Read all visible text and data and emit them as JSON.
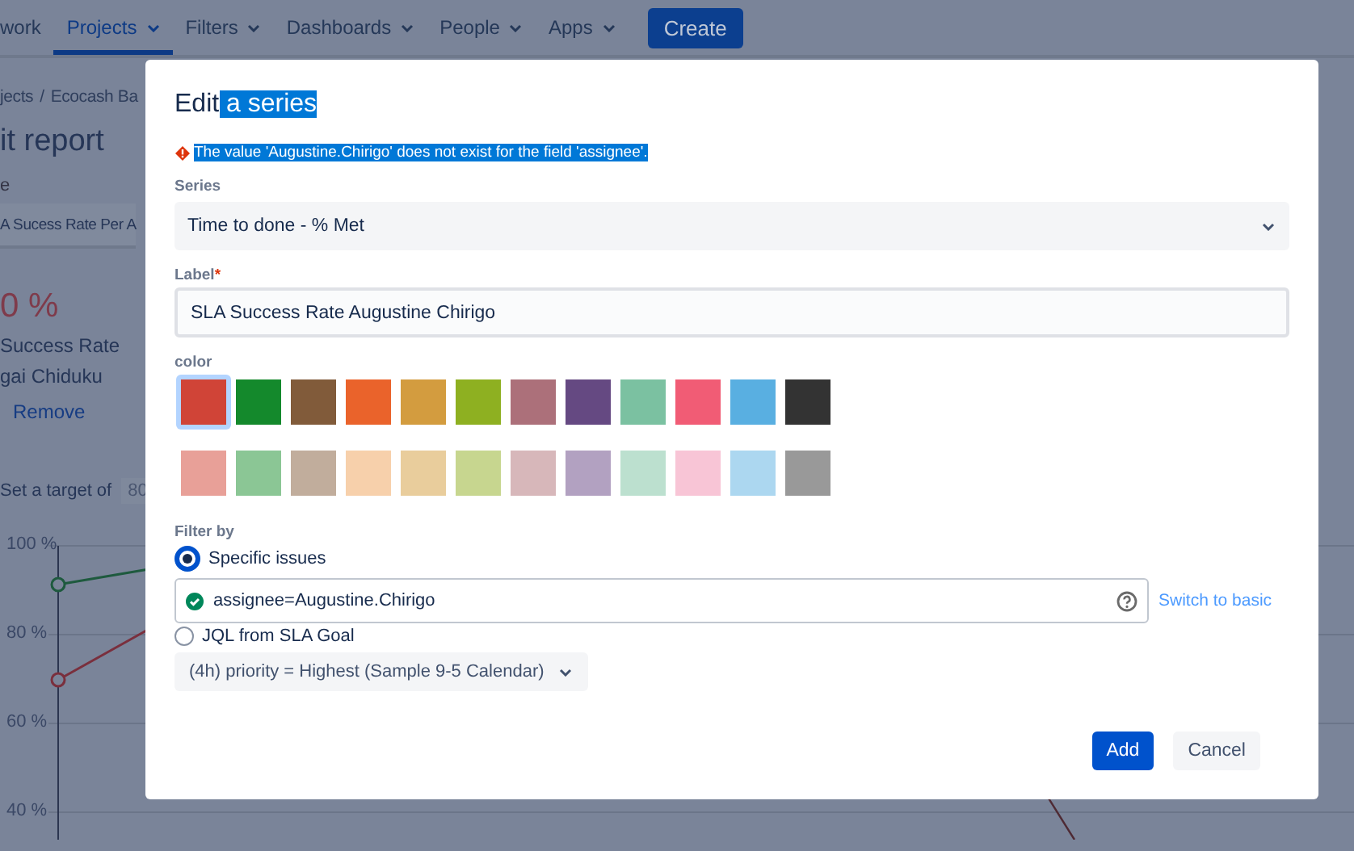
{
  "nav": {
    "items": [
      {
        "label": "work",
        "selected": false,
        "dropdown": false
      },
      {
        "label": "Projects",
        "selected": true,
        "dropdown": true
      },
      {
        "label": "Filters",
        "selected": false,
        "dropdown": true
      },
      {
        "label": "Dashboards",
        "selected": false,
        "dropdown": true
      },
      {
        "label": "People",
        "selected": false,
        "dropdown": true
      },
      {
        "label": "Apps",
        "selected": false,
        "dropdown": true
      }
    ],
    "create_button": "Create"
  },
  "background": {
    "breadcrumb": [
      "jects",
      "Ecocash Ba"
    ],
    "breadcrumb_separator": "/",
    "page_title": "it report",
    "field_label": "e",
    "report_select": "A Sucess Rate Per A",
    "percentage": "0 %",
    "series_lines": [
      "Success Rate",
      "gai Chiduku"
    ],
    "remove_link": "Remove",
    "target_label": "Set a target of",
    "target_value": "80",
    "chart_y_labels": [
      "100 %",
      "80 %",
      "60 %",
      "40 %"
    ]
  },
  "dialog": {
    "title_parts": [
      {
        "text": "Edit",
        "selected": false
      },
      {
        "text": " a series",
        "selected": true
      }
    ],
    "error": {
      "text": "The value 'Augustine.Chirigo' does not exist for the field 'assignee'.",
      "selected": true
    },
    "series_label": "Series",
    "series_value": "Time to done - % Met",
    "label_label": "Label",
    "label_required": "*",
    "label_value": "SLA Success Rate Augustine Chirigo",
    "color_label": "color",
    "colors": [
      {
        "color": "#d04437",
        "selected": true
      },
      {
        "color": "#14892c",
        "selected": false
      },
      {
        "color": "#815b3a",
        "selected": false
      },
      {
        "color": "#ea632b",
        "selected": false
      },
      {
        "color": "#d39c3f",
        "selected": false
      },
      {
        "color": "#8eb021",
        "selected": false
      },
      {
        "color": "#ac707a",
        "selected": false
      },
      {
        "color": "#654982",
        "selected": false
      },
      {
        "color": "#7bc1a1",
        "selected": false
      },
      {
        "color": "#f15c75",
        "selected": false
      },
      {
        "color": "#59afe1",
        "selected": false
      },
      {
        "color": "#333333",
        "selected": false
      },
      {
        "color": "#e8a098",
        "selected": false
      },
      {
        "color": "#8bc695",
        "selected": false
      },
      {
        "color": "#c1ad9c",
        "selected": false
      },
      {
        "color": "#f7d0ab",
        "selected": false
      },
      {
        "color": "#e9cd9c",
        "selected": false
      },
      {
        "color": "#c7d68f",
        "selected": false
      },
      {
        "color": "#d7b7ba",
        "selected": false
      },
      {
        "color": "#b2a1c1",
        "selected": false
      },
      {
        "color": "#bce0cf",
        "selected": false
      },
      {
        "color": "#f8c5d6",
        "selected": false
      },
      {
        "color": "#acd7f0",
        "selected": false
      },
      {
        "color": "#999999",
        "selected": false
      }
    ],
    "filter_label": "Filter by",
    "filter_options": [
      {
        "label": "Specific issues",
        "selected": true
      },
      {
        "label": "JQL from SLA Goal",
        "selected": false
      }
    ],
    "jql_value": "assignee=Augustine.Chirigo",
    "jql_valid": true,
    "switch_link": "Switch to basic",
    "goal_dropdown": "(4h) priority = Highest (Sample 9-5 Calendar)",
    "buttons": [
      {
        "label": "Add",
        "kind": "primary"
      },
      {
        "label": "Cancel",
        "kind": "subtle"
      }
    ]
  }
}
